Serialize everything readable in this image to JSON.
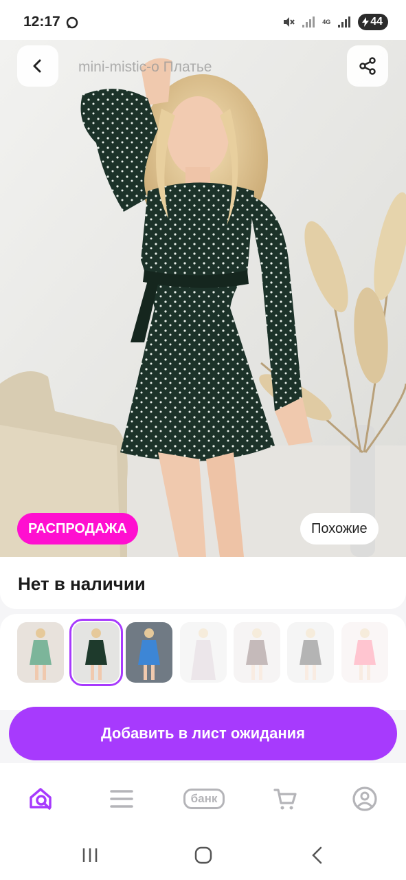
{
  "status_bar": {
    "time": "12:17",
    "network": "4G",
    "battery": "44"
  },
  "header": {
    "title": "mini-mistic-o Платье",
    "back_icon": "chevron-left-icon",
    "share_icon": "share-icon"
  },
  "hero": {
    "sale_badge": "РАСПРОДАЖА",
    "similar_button": "Похожие"
  },
  "availability": {
    "text": "Нет в наличии"
  },
  "variants": [
    {
      "color": "#8fc4a8",
      "dress": "#6fae8f"
    },
    {
      "color": "#2f3a33",
      "dress": "#1e3a2c"
    },
    {
      "color": "#8da3bf",
      "dress": "#3d86d6"
    },
    {
      "color": "#d8d4d4",
      "dress": "#c9b9c4"
    },
    {
      "color": "#d0cbc8",
      "dress": "#5c3b3b"
    },
    {
      "color": "#d8d8d8",
      "dress": "#2a2a2a"
    },
    {
      "color": "#f0dede",
      "dress": "#ff5b7a"
    }
  ],
  "cta": {
    "label": "Добавить в лист ожидания"
  },
  "bottom_nav": {
    "bank_label": "банк"
  },
  "colors": {
    "accent": "#a73afd",
    "sale": "#ff0fd0"
  }
}
